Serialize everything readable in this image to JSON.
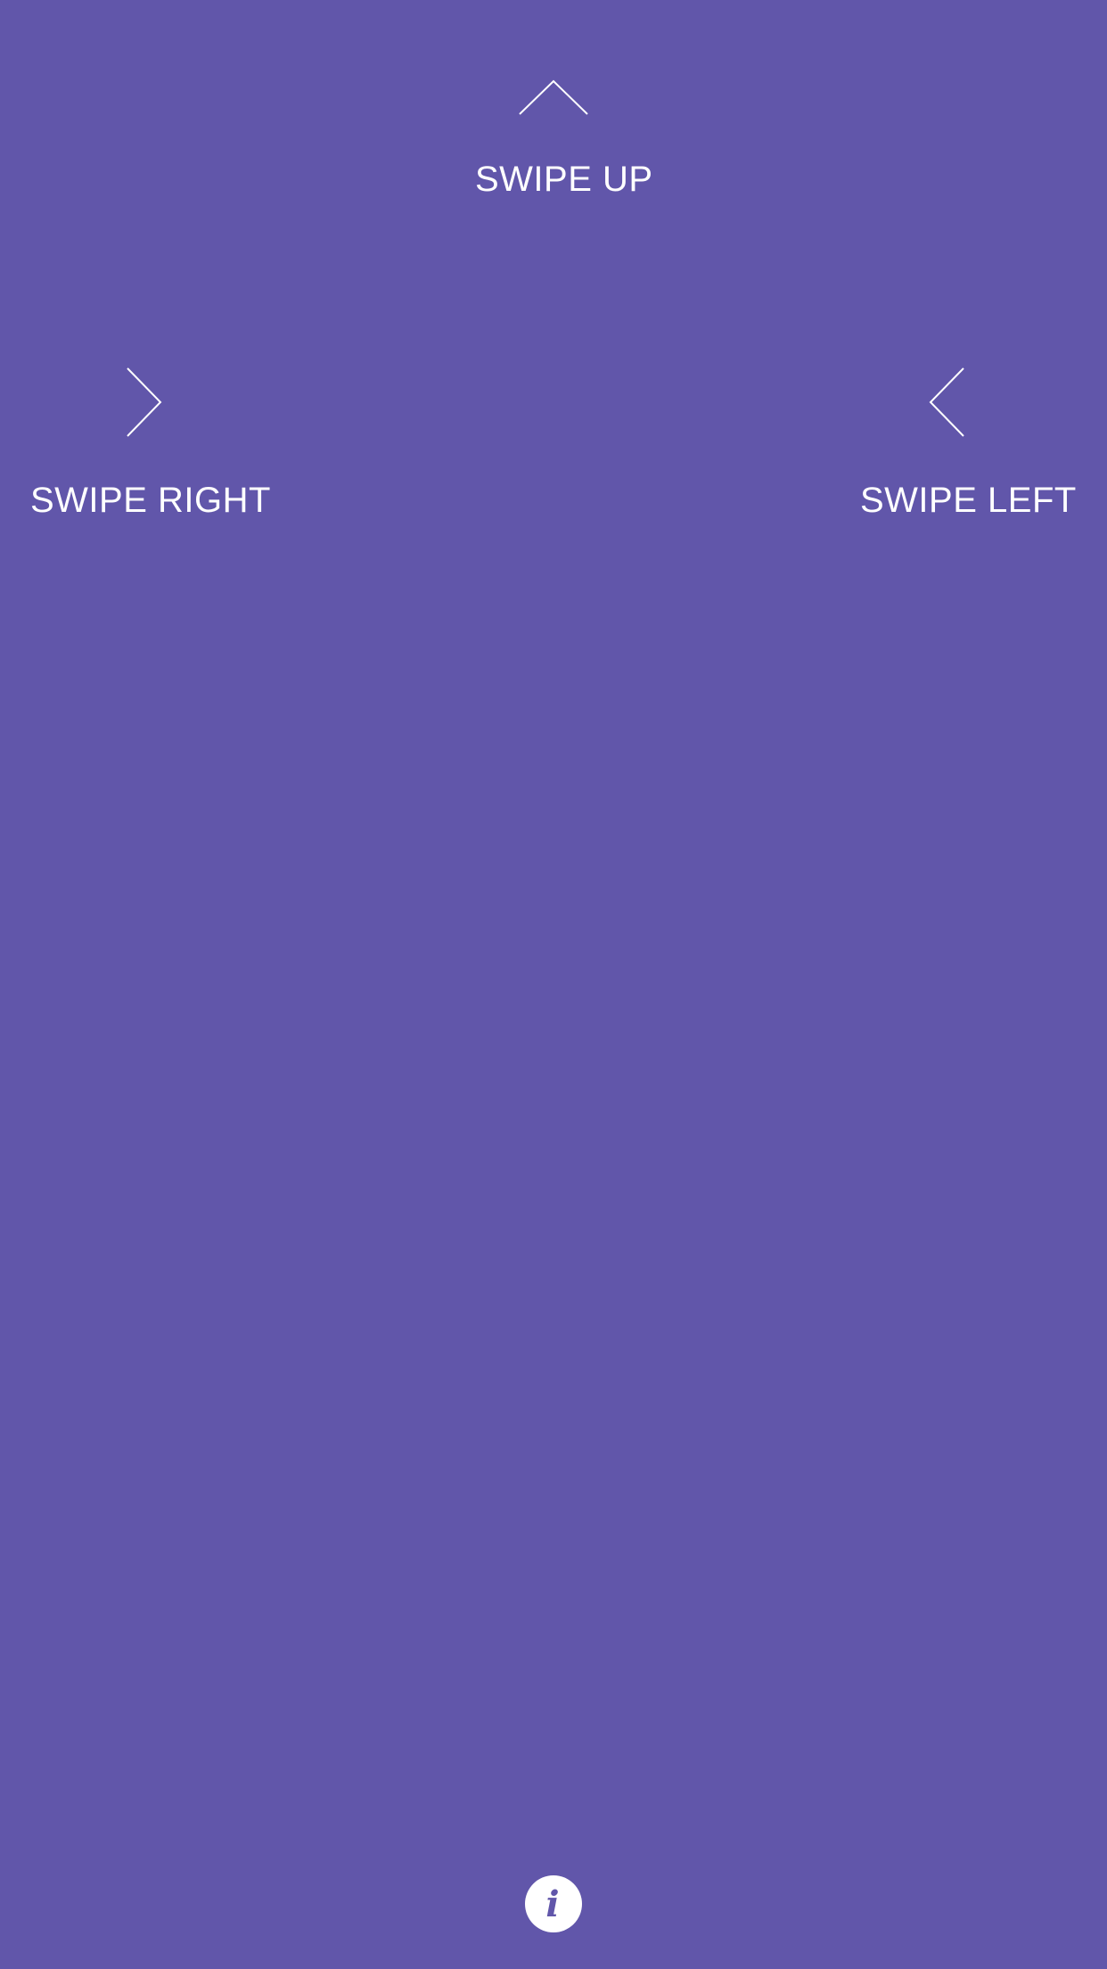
{
  "theme": {
    "background": "#6156aa",
    "foreground": "#ffffff"
  },
  "hints": {
    "up": {
      "icon": "chevron-up-icon",
      "label": "SWIPE UP"
    },
    "right": {
      "icon": "chevron-right-icon",
      "label": "SWIPE RIGHT"
    },
    "left": {
      "icon": "chevron-left-icon",
      "label": "SWIPE LEFT"
    }
  },
  "info_button": {
    "icon": "info-icon",
    "glyph": "i"
  }
}
